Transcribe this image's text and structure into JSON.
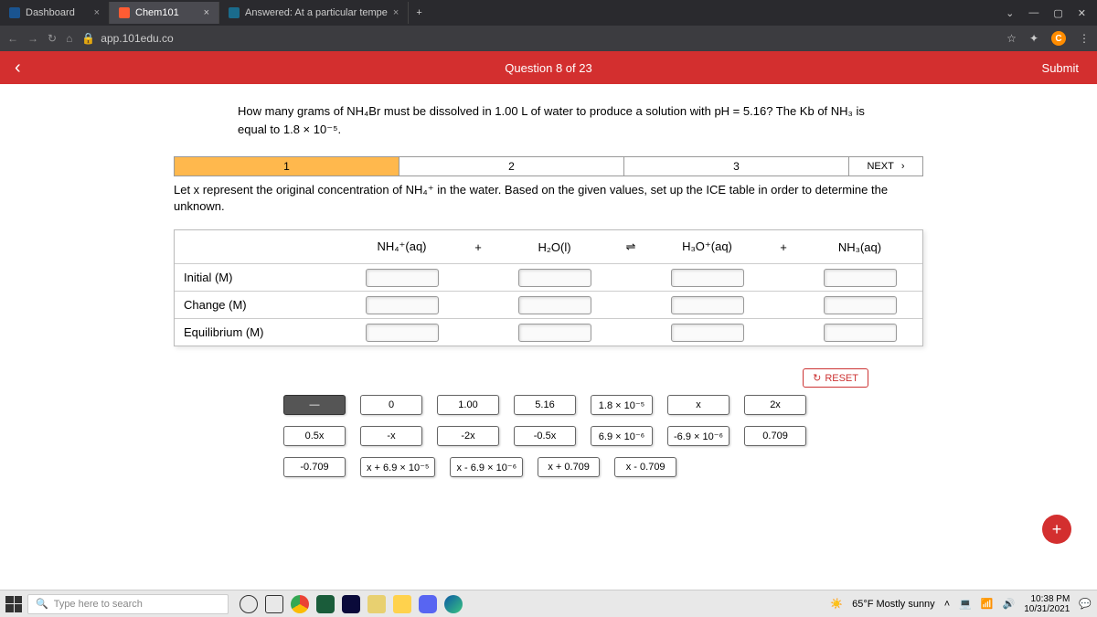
{
  "browser": {
    "tabs": [
      {
        "label": "Dashboard"
      },
      {
        "label": "Chem101"
      },
      {
        "label": "Answered: At a particular tempe"
      }
    ],
    "url": "app.101edu.co",
    "win": {
      "min": "—",
      "max": "▢",
      "close": "✕"
    }
  },
  "qbar": {
    "back": "‹",
    "title": "Question 8 of 23",
    "submit": "Submit"
  },
  "question": "How many grams of NH₄Br must be dissolved in 1.00 L of water to produce a solution with pH = 5.16? The Kb of NH₃ is equal to 1.8 × 10⁻⁵.",
  "steps": {
    "s1": "1",
    "s2": "2",
    "s3": "3",
    "next": "NEXT",
    "arrow": "›"
  },
  "hint": "Let x represent the original concentration of NH₄⁺ in the water. Based on the given values, set up the ICE table in order to determine the unknown.",
  "ice": {
    "species": [
      "NH₄⁺(aq)",
      "+",
      "H₂O(l)",
      "⇌",
      "H₃O⁺(aq)",
      "+",
      "NH₃(aq)"
    ],
    "rows": [
      "Initial (M)",
      "Change (M)",
      "Equilibrium (M)"
    ]
  },
  "reset": "RESET",
  "chips": [
    "—",
    "0",
    "1.00",
    "5.16",
    "1.8 × 10⁻⁵",
    "x",
    "2x",
    "0.5x",
    "-x",
    "-2x",
    "-0.5x",
    "6.9 × 10⁻⁶",
    "-6.9 × 10⁻⁶",
    "0.709",
    "-0.709",
    "x + 6.9 × 10⁻⁵",
    "x - 6.9 × 10⁻⁶",
    "x + 0.709",
    "x - 0.709"
  ],
  "fab": "+",
  "taskbar": {
    "search_placeholder": "Type here to search",
    "weather": "65°F Mostly sunny",
    "time": "10:38 PM",
    "date": "10/31/2021"
  }
}
